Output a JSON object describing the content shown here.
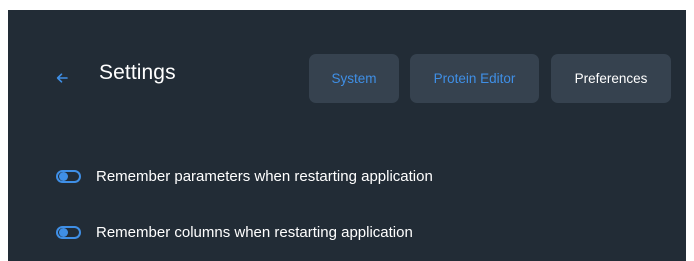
{
  "header": {
    "title": "Settings",
    "back_icon": "arrow-left-icon"
  },
  "tabs": [
    {
      "label": "System",
      "active": false
    },
    {
      "label": "Protein Editor",
      "active": false
    },
    {
      "label": "Preferences",
      "active": true
    }
  ],
  "preferences": [
    {
      "label": "Remember parameters when restarting application",
      "enabled": true
    },
    {
      "label": "Remember columns when restarting application",
      "enabled": true
    }
  ],
  "colors": {
    "background": "#222c36",
    "tab_background": "#36424f",
    "accent": "#3f8fe6",
    "text": "#ffffff"
  }
}
